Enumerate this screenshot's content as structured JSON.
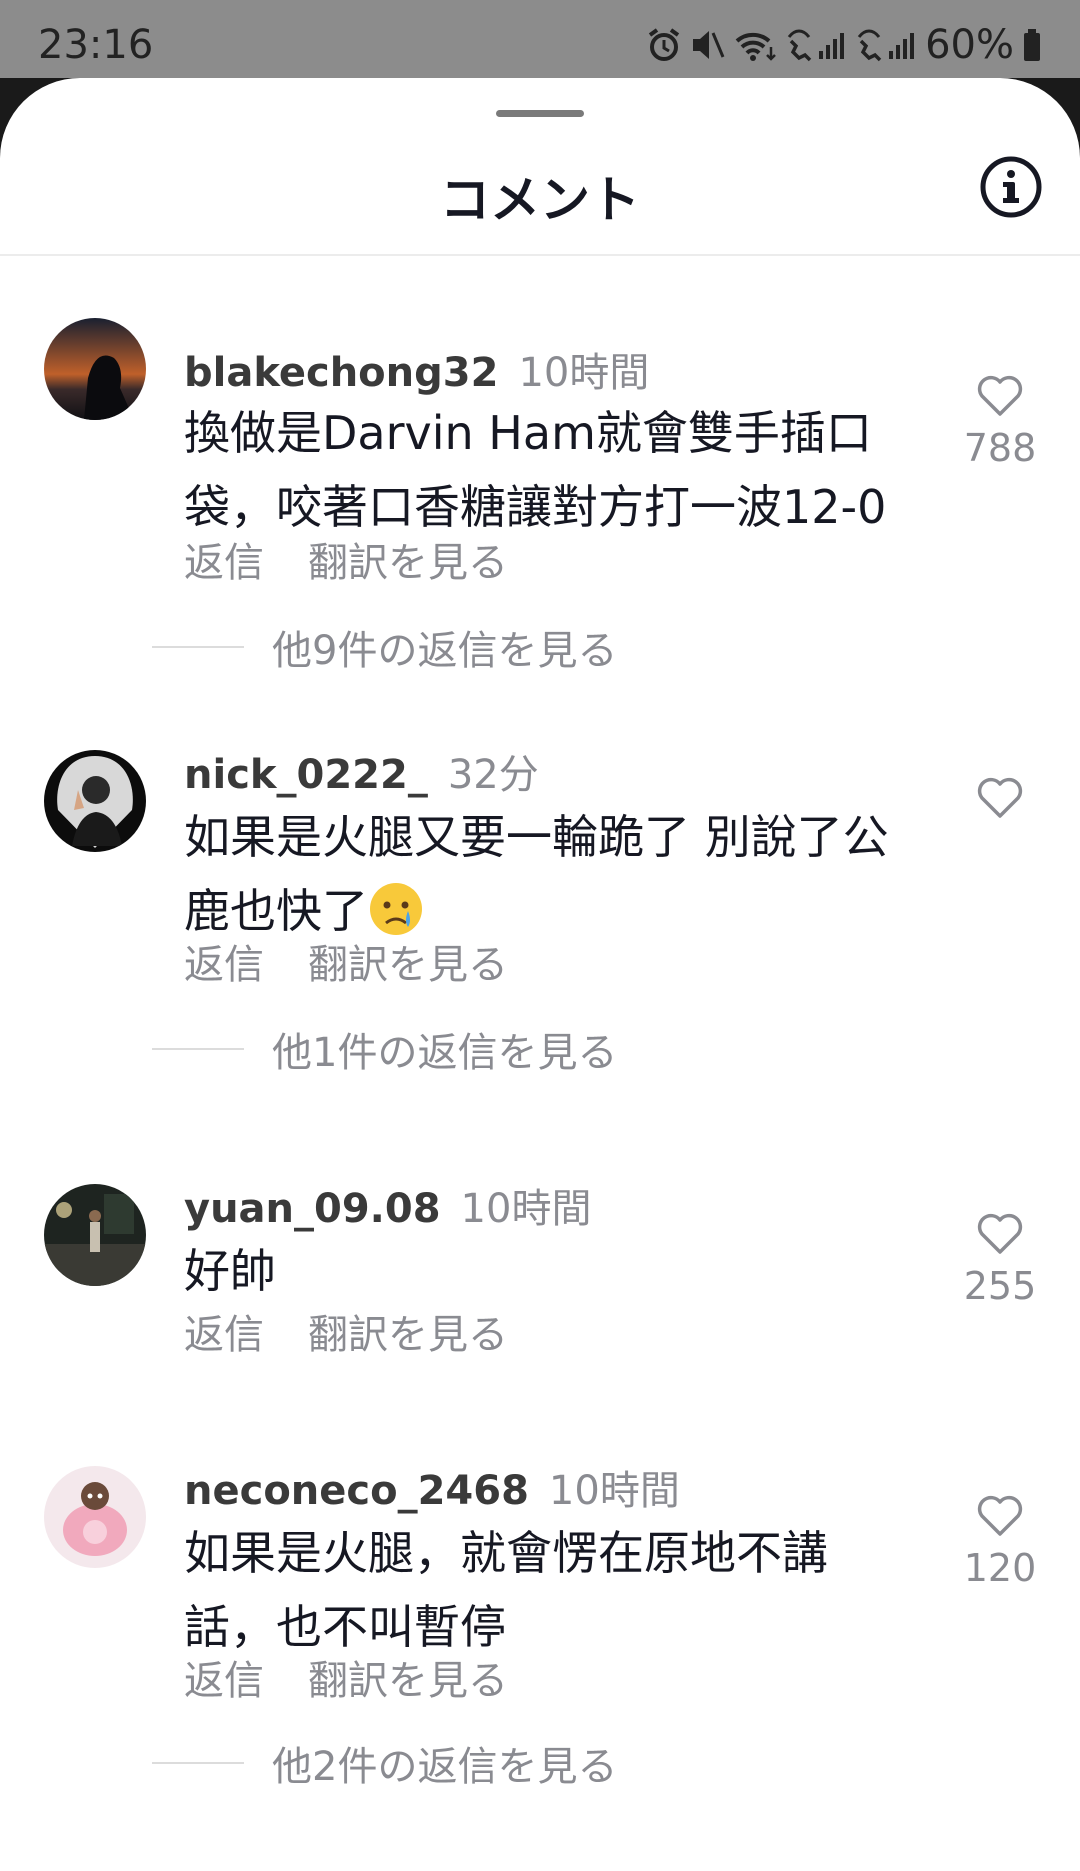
{
  "status_bar": {
    "time": "23:16",
    "battery": "60%"
  },
  "header": {
    "title": "コメント"
  },
  "comments": [
    {
      "username": "blakechong32",
      "time": "10時間",
      "text_line1": "換做是Darvin Ham就會雙手插口",
      "text_line2": "袋，咬著口香糖讓對方打一波12-0",
      "reply_label": "返信",
      "translate_label": "翻訳を見る",
      "likes": "788",
      "more_replies": "他9件の返信を見る"
    },
    {
      "username": "nick_0222_",
      "time": "32分",
      "text_line1": "如果是火腿又要一輪跪了 別說了公",
      "text_line2": "鹿也快了",
      "emoji": "crying-face",
      "reply_label": "返信",
      "translate_label": "翻訳を見る",
      "likes": "",
      "more_replies": "他1件の返信を見る"
    },
    {
      "username": "yuan_09.08",
      "time": "10時間",
      "text_line1": "好帥",
      "reply_label": "返信",
      "translate_label": "翻訳を見る",
      "likes": "255"
    },
    {
      "username": "neconeco_2468",
      "time": "10時間",
      "text_line1": "如果是火腿，就會愣在原地不講",
      "text_line2": "話，也不叫暫停",
      "reply_label": "返信",
      "translate_label": "翻訳を見る",
      "likes": "120",
      "more_replies": "他2件の返信を見る"
    }
  ],
  "icons": {
    "info": "info-circle-icon",
    "like": "heart-outline-icon"
  }
}
